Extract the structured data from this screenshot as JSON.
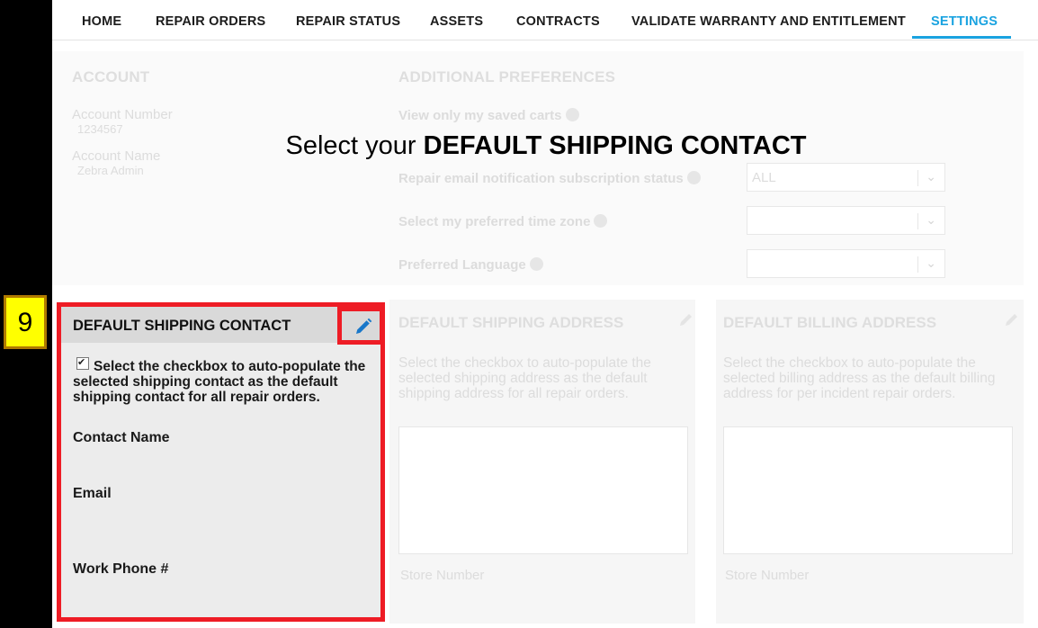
{
  "nav": {
    "items": [
      {
        "label": "HOME"
      },
      {
        "label": "REPAIR ORDERS"
      },
      {
        "label": "REPAIR STATUS"
      },
      {
        "label": "ASSETS"
      },
      {
        "label": "CONTRACTS"
      },
      {
        "label": "VALIDATE WARRANTY AND ENTITLEMENT"
      },
      {
        "label": "SETTINGS"
      }
    ],
    "active": "SETTINGS"
  },
  "account": {
    "title": "ACCOUNT",
    "number_label": "Account Number",
    "number_value": "1234567",
    "name_label": "Account Name",
    "name_value": "Zebra Admin"
  },
  "preferences": {
    "title": "ADDITIONAL PREFERENCES",
    "saved_carts": "View only my saved carts",
    "repair_email": "Repair email notification subscription status",
    "repair_email_value": "ALL",
    "time_zone": "Select my preferred time zone",
    "language": "Preferred Language"
  },
  "instruction": {
    "prefix": "Select your ",
    "emphasis": "DEFAULT SHIPPING CONTACT"
  },
  "step_number": "9",
  "shipping_contact": {
    "title": "DEFAULT SHIPPING CONTACT",
    "checkbox_text": "Select the checkbox to auto-populate the selected shipping contact as the default shipping contact for all repair orders.",
    "contact_name_label": "Contact Name",
    "email_label": "Email",
    "phone_label": "Work Phone #"
  },
  "shipping_address": {
    "title": "DEFAULT SHIPPING ADDRESS",
    "checkbox_text": "Select the checkbox to auto-populate the selected shipping address as the default shipping address for all repair orders.",
    "store_label": "Store Number"
  },
  "billing_address": {
    "title": "DEFAULT BILLING ADDRESS",
    "checkbox_text": "Select the checkbox to auto-populate the selected billing address as the default billing address for per incident repair orders.",
    "store_label": "Store Number"
  },
  "colors": {
    "accent": "#1aa3e0",
    "highlight_border": "#ee1c25",
    "badge_fill": "#ffff00"
  }
}
